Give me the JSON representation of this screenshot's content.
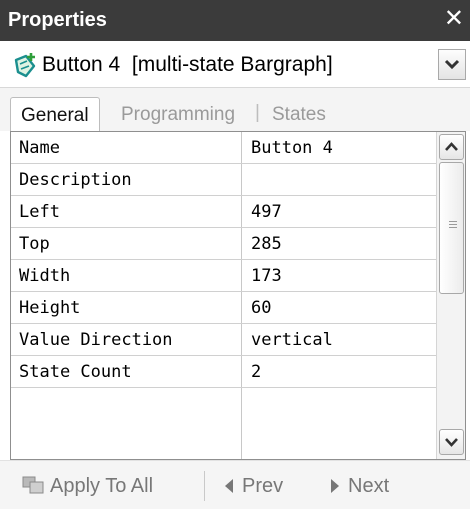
{
  "window": {
    "title": "Properties",
    "close_icon": "close-icon"
  },
  "selector": {
    "object_label": "Button 4  [multi-state Bargraph]",
    "object_icon": "bargraph-object-icon",
    "dropdown_icon": "chevron-down-icon"
  },
  "tabs": [
    {
      "label": "General",
      "active": true
    },
    {
      "label": "Programming",
      "active": false
    },
    {
      "label": "States",
      "active": false
    }
  ],
  "tab_separator": "|",
  "properties": [
    {
      "name": "Name",
      "value": "Button 4"
    },
    {
      "name": "Description",
      "value": ""
    },
    {
      "name": "Left",
      "value": "497"
    },
    {
      "name": "Top",
      "value": "285"
    },
    {
      "name": "Width",
      "value": "173"
    },
    {
      "name": "Height",
      "value": "60"
    },
    {
      "name": "Value Direction",
      "value": "vertical"
    },
    {
      "name": "State Count",
      "value": "2"
    }
  ],
  "footer": {
    "apply_label": "Apply To All",
    "prev_label": "Prev",
    "next_label": "Next"
  },
  "colors": {
    "titlebar_bg": "#3b3b3b",
    "icon_green": "#2e9e3a",
    "icon_teal": "#1b8f8f"
  }
}
